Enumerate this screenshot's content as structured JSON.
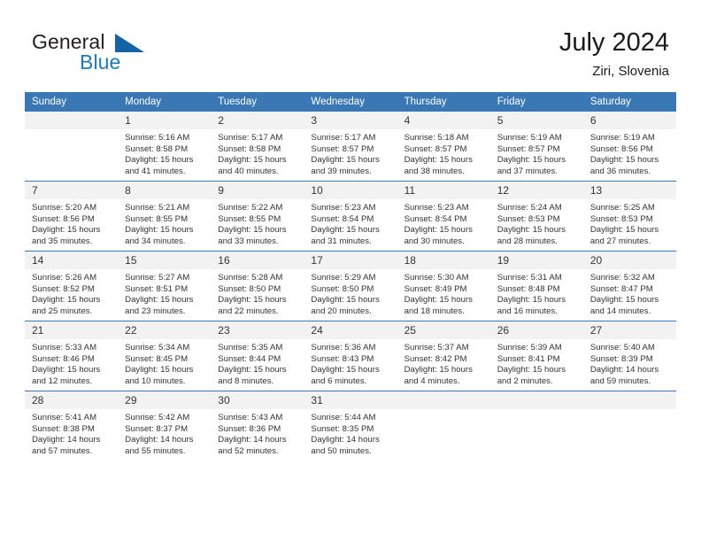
{
  "brand": {
    "name_top": "General",
    "name_bottom": "Blue",
    "triangle_color": "#1464a5",
    "blue_text_color": "#1a7abf"
  },
  "header": {
    "title": "July 2024",
    "location": "Ziri, Slovenia",
    "accent_color": "#3a78b5",
    "daynum_band_color": "#f2f2f2"
  },
  "weekdays": [
    "Sunday",
    "Monday",
    "Tuesday",
    "Wednesday",
    "Thursday",
    "Friday",
    "Saturday"
  ],
  "weeks": [
    [
      {
        "day": "",
        "sunrise": "",
        "sunset": "",
        "daylight_line1": "",
        "daylight_line2": ""
      },
      {
        "day": "1",
        "sunrise": "Sunrise: 5:16 AM",
        "sunset": "Sunset: 8:58 PM",
        "daylight_line1": "Daylight: 15 hours",
        "daylight_line2": "and 41 minutes."
      },
      {
        "day": "2",
        "sunrise": "Sunrise: 5:17 AM",
        "sunset": "Sunset: 8:58 PM",
        "daylight_line1": "Daylight: 15 hours",
        "daylight_line2": "and 40 minutes."
      },
      {
        "day": "3",
        "sunrise": "Sunrise: 5:17 AM",
        "sunset": "Sunset: 8:57 PM",
        "daylight_line1": "Daylight: 15 hours",
        "daylight_line2": "and 39 minutes."
      },
      {
        "day": "4",
        "sunrise": "Sunrise: 5:18 AM",
        "sunset": "Sunset: 8:57 PM",
        "daylight_line1": "Daylight: 15 hours",
        "daylight_line2": "and 38 minutes."
      },
      {
        "day": "5",
        "sunrise": "Sunrise: 5:19 AM",
        "sunset": "Sunset: 8:57 PM",
        "daylight_line1": "Daylight: 15 hours",
        "daylight_line2": "and 37 minutes."
      },
      {
        "day": "6",
        "sunrise": "Sunrise: 5:19 AM",
        "sunset": "Sunset: 8:56 PM",
        "daylight_line1": "Daylight: 15 hours",
        "daylight_line2": "and 36 minutes."
      }
    ],
    [
      {
        "day": "7",
        "sunrise": "Sunrise: 5:20 AM",
        "sunset": "Sunset: 8:56 PM",
        "daylight_line1": "Daylight: 15 hours",
        "daylight_line2": "and 35 minutes."
      },
      {
        "day": "8",
        "sunrise": "Sunrise: 5:21 AM",
        "sunset": "Sunset: 8:55 PM",
        "daylight_line1": "Daylight: 15 hours",
        "daylight_line2": "and 34 minutes."
      },
      {
        "day": "9",
        "sunrise": "Sunrise: 5:22 AM",
        "sunset": "Sunset: 8:55 PM",
        "daylight_line1": "Daylight: 15 hours",
        "daylight_line2": "and 33 minutes."
      },
      {
        "day": "10",
        "sunrise": "Sunrise: 5:23 AM",
        "sunset": "Sunset: 8:54 PM",
        "daylight_line1": "Daylight: 15 hours",
        "daylight_line2": "and 31 minutes."
      },
      {
        "day": "11",
        "sunrise": "Sunrise: 5:23 AM",
        "sunset": "Sunset: 8:54 PM",
        "daylight_line1": "Daylight: 15 hours",
        "daylight_line2": "and 30 minutes."
      },
      {
        "day": "12",
        "sunrise": "Sunrise: 5:24 AM",
        "sunset": "Sunset: 8:53 PM",
        "daylight_line1": "Daylight: 15 hours",
        "daylight_line2": "and 28 minutes."
      },
      {
        "day": "13",
        "sunrise": "Sunrise: 5:25 AM",
        "sunset": "Sunset: 8:53 PM",
        "daylight_line1": "Daylight: 15 hours",
        "daylight_line2": "and 27 minutes."
      }
    ],
    [
      {
        "day": "14",
        "sunrise": "Sunrise: 5:26 AM",
        "sunset": "Sunset: 8:52 PM",
        "daylight_line1": "Daylight: 15 hours",
        "daylight_line2": "and 25 minutes."
      },
      {
        "day": "15",
        "sunrise": "Sunrise: 5:27 AM",
        "sunset": "Sunset: 8:51 PM",
        "daylight_line1": "Daylight: 15 hours",
        "daylight_line2": "and 23 minutes."
      },
      {
        "day": "16",
        "sunrise": "Sunrise: 5:28 AM",
        "sunset": "Sunset: 8:50 PM",
        "daylight_line1": "Daylight: 15 hours",
        "daylight_line2": "and 22 minutes."
      },
      {
        "day": "17",
        "sunrise": "Sunrise: 5:29 AM",
        "sunset": "Sunset: 8:50 PM",
        "daylight_line1": "Daylight: 15 hours",
        "daylight_line2": "and 20 minutes."
      },
      {
        "day": "18",
        "sunrise": "Sunrise: 5:30 AM",
        "sunset": "Sunset: 8:49 PM",
        "daylight_line1": "Daylight: 15 hours",
        "daylight_line2": "and 18 minutes."
      },
      {
        "day": "19",
        "sunrise": "Sunrise: 5:31 AM",
        "sunset": "Sunset: 8:48 PM",
        "daylight_line1": "Daylight: 15 hours",
        "daylight_line2": "and 16 minutes."
      },
      {
        "day": "20",
        "sunrise": "Sunrise: 5:32 AM",
        "sunset": "Sunset: 8:47 PM",
        "daylight_line1": "Daylight: 15 hours",
        "daylight_line2": "and 14 minutes."
      }
    ],
    [
      {
        "day": "21",
        "sunrise": "Sunrise: 5:33 AM",
        "sunset": "Sunset: 8:46 PM",
        "daylight_line1": "Daylight: 15 hours",
        "daylight_line2": "and 12 minutes."
      },
      {
        "day": "22",
        "sunrise": "Sunrise: 5:34 AM",
        "sunset": "Sunset: 8:45 PM",
        "daylight_line1": "Daylight: 15 hours",
        "daylight_line2": "and 10 minutes."
      },
      {
        "day": "23",
        "sunrise": "Sunrise: 5:35 AM",
        "sunset": "Sunset: 8:44 PM",
        "daylight_line1": "Daylight: 15 hours",
        "daylight_line2": "and 8 minutes."
      },
      {
        "day": "24",
        "sunrise": "Sunrise: 5:36 AM",
        "sunset": "Sunset: 8:43 PM",
        "daylight_line1": "Daylight: 15 hours",
        "daylight_line2": "and 6 minutes."
      },
      {
        "day": "25",
        "sunrise": "Sunrise: 5:37 AM",
        "sunset": "Sunset: 8:42 PM",
        "daylight_line1": "Daylight: 15 hours",
        "daylight_line2": "and 4 minutes."
      },
      {
        "day": "26",
        "sunrise": "Sunrise: 5:39 AM",
        "sunset": "Sunset: 8:41 PM",
        "daylight_line1": "Daylight: 15 hours",
        "daylight_line2": "and 2 minutes."
      },
      {
        "day": "27",
        "sunrise": "Sunrise: 5:40 AM",
        "sunset": "Sunset: 8:39 PM",
        "daylight_line1": "Daylight: 14 hours",
        "daylight_line2": "and 59 minutes."
      }
    ],
    [
      {
        "day": "28",
        "sunrise": "Sunrise: 5:41 AM",
        "sunset": "Sunset: 8:38 PM",
        "daylight_line1": "Daylight: 14 hours",
        "daylight_line2": "and 57 minutes."
      },
      {
        "day": "29",
        "sunrise": "Sunrise: 5:42 AM",
        "sunset": "Sunset: 8:37 PM",
        "daylight_line1": "Daylight: 14 hours",
        "daylight_line2": "and 55 minutes."
      },
      {
        "day": "30",
        "sunrise": "Sunrise: 5:43 AM",
        "sunset": "Sunset: 8:36 PM",
        "daylight_line1": "Daylight: 14 hours",
        "daylight_line2": "and 52 minutes."
      },
      {
        "day": "31",
        "sunrise": "Sunrise: 5:44 AM",
        "sunset": "Sunset: 8:35 PM",
        "daylight_line1": "Daylight: 14 hours",
        "daylight_line2": "and 50 minutes."
      },
      {
        "day": "",
        "sunrise": "",
        "sunset": "",
        "daylight_line1": "",
        "daylight_line2": ""
      },
      {
        "day": "",
        "sunrise": "",
        "sunset": "",
        "daylight_line1": "",
        "daylight_line2": ""
      },
      {
        "day": "",
        "sunrise": "",
        "sunset": "",
        "daylight_line1": "",
        "daylight_line2": ""
      }
    ]
  ]
}
